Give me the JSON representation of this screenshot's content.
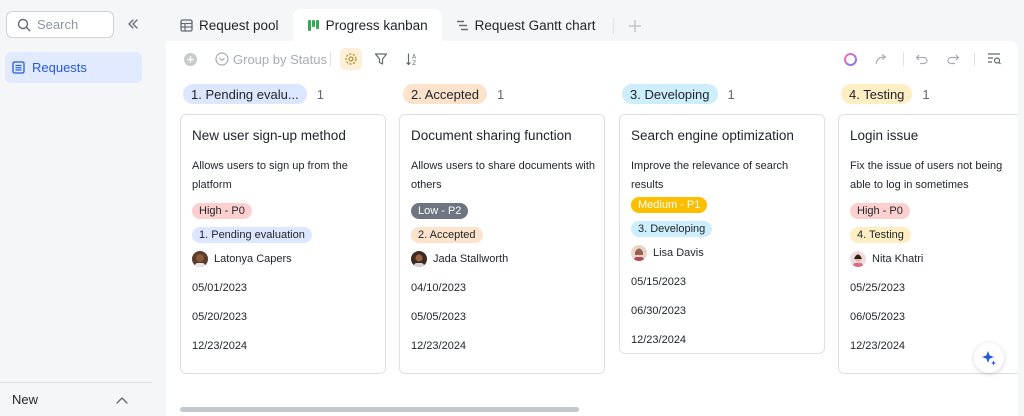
{
  "sidebar": {
    "search_placeholder": "Search",
    "items": [
      {
        "label": "Requests"
      }
    ],
    "bottom_label": "New"
  },
  "tabs": [
    {
      "label": "Request pool",
      "icon": "table-icon"
    },
    {
      "label": "Progress kanban",
      "icon": "kanban-icon",
      "active": true
    },
    {
      "label": "Request Gantt chart",
      "icon": "gantt-icon"
    }
  ],
  "toolbar": {
    "group_by_label": "Group by Status"
  },
  "colors": {
    "accent": "#245bdb",
    "pending": "#dce6ff",
    "accepted": "#fde2cc",
    "developing": "#cdeefd",
    "testing": "#fdefc3",
    "high": "#fbd0cf",
    "medium": "#fbbf00",
    "low": "#6e7580"
  },
  "columns": [
    {
      "status": "1. Pending evalu...",
      "count": "1",
      "color": "#dce6ff",
      "card": {
        "title": "New user sign-up method",
        "description": "Allows users to sign up from the platform",
        "priority": "High - P0",
        "priority_color": "#fbd0cf",
        "priority_text_color": "#1f2329",
        "status_chip": "1. Pending evaluation",
        "status_color": "#dce6ff",
        "assignee": "Latonya Capers",
        "dates": [
          "05/01/2023",
          "05/20/2023",
          "12/23/2024"
        ]
      }
    },
    {
      "status": "2. Accepted",
      "count": "1",
      "color": "#fde2cc",
      "card": {
        "title": "Document sharing function",
        "description": "Allows users to share documents with others",
        "priority": "Low - P2",
        "priority_color": "#6e7580",
        "priority_text_color": "#ffffff",
        "status_chip": "2. Accepted",
        "status_color": "#fde2cc",
        "assignee": "Jada Stallworth",
        "dates": [
          "04/10/2023",
          "05/05/2023",
          "12/23/2024"
        ]
      }
    },
    {
      "status": "3. Developing",
      "count": "1",
      "color": "#cdeefd",
      "card": {
        "title": "Search engine optimization",
        "description": "Improve the relevance of search results",
        "priority": "Medium - P1",
        "priority_color": "#fbbf00",
        "priority_text_color": "#ffffff",
        "status_chip": "3. Developing",
        "status_color": "#cdeefd",
        "assignee": "Lisa Davis",
        "dates": [
          "05/15/2023",
          "06/30/2023",
          "12/23/2024"
        ]
      }
    },
    {
      "status": "4. Testing",
      "count": "1",
      "color": "#fdefc3",
      "card": {
        "title": "Login issue",
        "description": "Fix the issue of users not being able to log in sometimes",
        "priority": "High - P0",
        "priority_color": "#fbd0cf",
        "priority_text_color": "#1f2329",
        "status_chip": "4. Testing",
        "status_color": "#fdefc3",
        "assignee": "Nita Khatri",
        "dates": [
          "05/25/2023",
          "06/05/2023",
          "12/23/2024"
        ]
      }
    }
  ]
}
